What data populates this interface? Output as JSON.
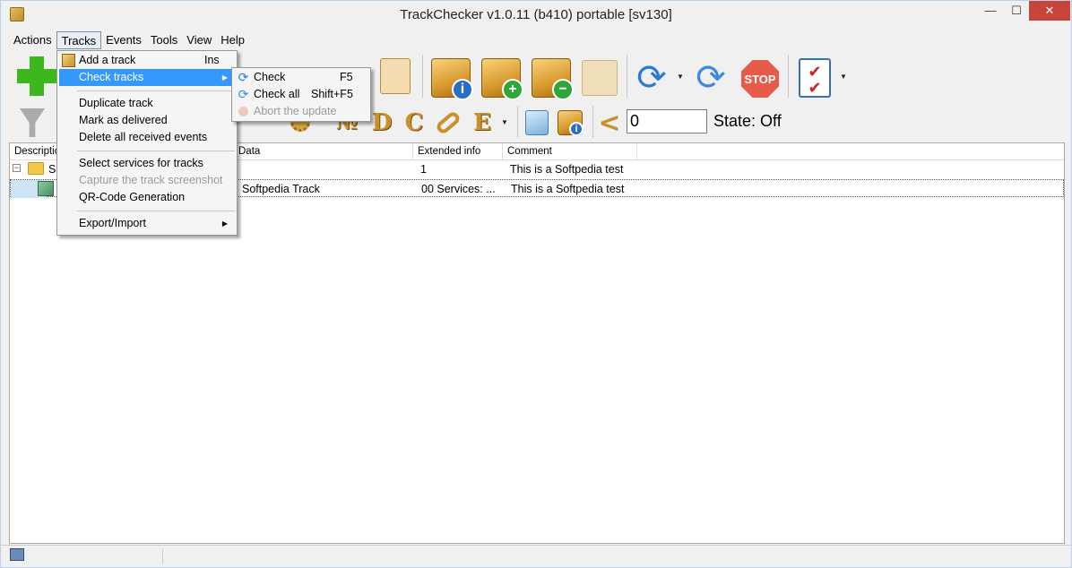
{
  "window": {
    "title": "TrackChecker v1.0.11 (b410)  portable [sv130]"
  },
  "menubar": {
    "items": [
      "Actions",
      "Tracks",
      "Events",
      "Tools",
      "View",
      "Help"
    ]
  },
  "toolbar2": {
    "counter_value": "0",
    "state_label": "State: Off",
    "letters": [
      "№",
      "D",
      "C",
      "E"
    ],
    "less_than": "<"
  },
  "grid": {
    "columns": [
      "Description",
      "Data",
      "Extended info",
      "Comment"
    ],
    "rows": [
      {
        "description": "S",
        "data": "",
        "extended": "1",
        "comment": "This is a Softpedia test"
      },
      {
        "description": "",
        "data": "Softpedia Track",
        "extended": "00 Services: ...",
        "comment": "This is a Softpedia test"
      }
    ]
  },
  "tracks_menu": {
    "add_track": "Add a track",
    "add_track_shortcut": "Ins",
    "check_tracks": "Check tracks",
    "duplicate_track": "Duplicate track",
    "mark_delivered": "Mark as delivered",
    "delete_events": "Delete all received events",
    "select_services": "Select services for tracks",
    "capture_screenshot": "Capture the track screenshot",
    "qr_code": "QR-Code Generation",
    "export_import": "Export/Import"
  },
  "check_submenu": {
    "check": "Check",
    "check_shortcut": "F5",
    "check_all": "Check all",
    "check_all_shortcut": "Shift+F5",
    "abort": "Abort the update"
  },
  "toolbar1": {
    "stop_label": "STOP"
  },
  "colors": {
    "highlight": "#3399ff",
    "close_button": "#c7443a"
  },
  "icons": [
    "app-icon",
    "add-icon",
    "box-info-icon",
    "box-add-icon",
    "box-remove-icon",
    "boxes-check-icon",
    "refresh-icon",
    "refresh-all-icon",
    "stop-icon",
    "checklist-icon",
    "filter-icon"
  ]
}
